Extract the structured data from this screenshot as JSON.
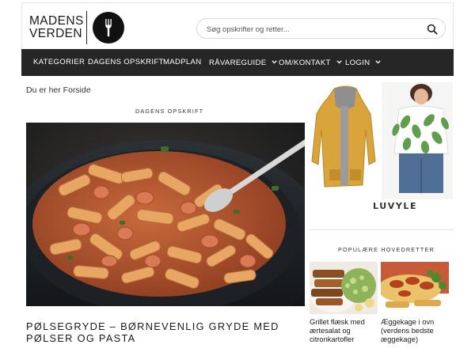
{
  "site": {
    "logo_line1": "MADENS",
    "logo_line2": "VERDEN"
  },
  "search": {
    "placeholder": "Søg opskrifter og retter..."
  },
  "nav": {
    "items": [
      {
        "label": "KATEGORIER",
        "dropdown": false
      },
      {
        "label": "DAGENS OPSKRIFT",
        "dropdown": false
      },
      {
        "label": "MADPLAN",
        "dropdown": false
      },
      {
        "label": "RÅVAREGUIDE",
        "dropdown": true
      },
      {
        "label": "OM/KONTAKT",
        "dropdown": true
      },
      {
        "label": "LOGIN",
        "dropdown": true
      }
    ]
  },
  "breadcrumb": "Du er her Forside",
  "main": {
    "section_label": "DAGENS OPSKRIFT",
    "recipe_title": "PØLSEGRYDE – BØRNEVENLIG GRYDE MED PØLSER OG PASTA"
  },
  "ad": {
    "brand": "LUVYLE"
  },
  "sidebar": {
    "section_label": "POPULÆRE HOVEDRETTER",
    "cards": [
      {
        "title": "Grillet flæsk med ærtesalat og citronkartofler"
      },
      {
        "title": "Æggekage i ovn (verdens bedste æggekage)"
      }
    ]
  },
  "colors": {
    "nav_bg": "#262626",
    "nav_text": "#ffffff",
    "accent": "#111111"
  }
}
